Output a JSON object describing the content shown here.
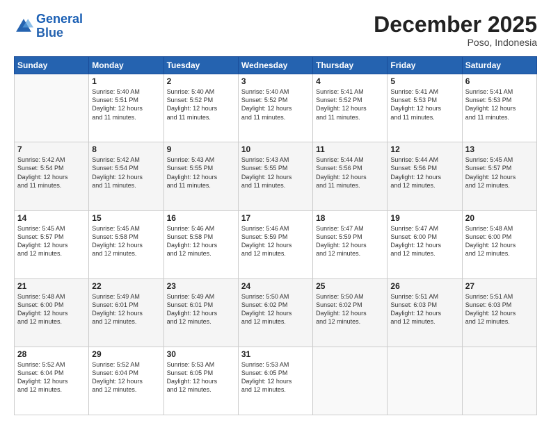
{
  "logo": {
    "line1": "General",
    "line2": "Blue"
  },
  "header": {
    "month": "December 2025",
    "location": "Poso, Indonesia"
  },
  "weekdays": [
    "Sunday",
    "Monday",
    "Tuesday",
    "Wednesday",
    "Thursday",
    "Friday",
    "Saturday"
  ],
  "weeks": [
    [
      {
        "day": "",
        "info": ""
      },
      {
        "day": "1",
        "info": "Sunrise: 5:40 AM\nSunset: 5:51 PM\nDaylight: 12 hours\nand 11 minutes."
      },
      {
        "day": "2",
        "info": "Sunrise: 5:40 AM\nSunset: 5:52 PM\nDaylight: 12 hours\nand 11 minutes."
      },
      {
        "day": "3",
        "info": "Sunrise: 5:40 AM\nSunset: 5:52 PM\nDaylight: 12 hours\nand 11 minutes."
      },
      {
        "day": "4",
        "info": "Sunrise: 5:41 AM\nSunset: 5:52 PM\nDaylight: 12 hours\nand 11 minutes."
      },
      {
        "day": "5",
        "info": "Sunrise: 5:41 AM\nSunset: 5:53 PM\nDaylight: 12 hours\nand 11 minutes."
      },
      {
        "day": "6",
        "info": "Sunrise: 5:41 AM\nSunset: 5:53 PM\nDaylight: 12 hours\nand 11 minutes."
      }
    ],
    [
      {
        "day": "7",
        "info": "Sunrise: 5:42 AM\nSunset: 5:54 PM\nDaylight: 12 hours\nand 11 minutes."
      },
      {
        "day": "8",
        "info": "Sunrise: 5:42 AM\nSunset: 5:54 PM\nDaylight: 12 hours\nand 11 minutes."
      },
      {
        "day": "9",
        "info": "Sunrise: 5:43 AM\nSunset: 5:55 PM\nDaylight: 12 hours\nand 11 minutes."
      },
      {
        "day": "10",
        "info": "Sunrise: 5:43 AM\nSunset: 5:55 PM\nDaylight: 12 hours\nand 11 minutes."
      },
      {
        "day": "11",
        "info": "Sunrise: 5:44 AM\nSunset: 5:56 PM\nDaylight: 12 hours\nand 11 minutes."
      },
      {
        "day": "12",
        "info": "Sunrise: 5:44 AM\nSunset: 5:56 PM\nDaylight: 12 hours\nand 12 minutes."
      },
      {
        "day": "13",
        "info": "Sunrise: 5:45 AM\nSunset: 5:57 PM\nDaylight: 12 hours\nand 12 minutes."
      }
    ],
    [
      {
        "day": "14",
        "info": "Sunrise: 5:45 AM\nSunset: 5:57 PM\nDaylight: 12 hours\nand 12 minutes."
      },
      {
        "day": "15",
        "info": "Sunrise: 5:45 AM\nSunset: 5:58 PM\nDaylight: 12 hours\nand 12 minutes."
      },
      {
        "day": "16",
        "info": "Sunrise: 5:46 AM\nSunset: 5:58 PM\nDaylight: 12 hours\nand 12 minutes."
      },
      {
        "day": "17",
        "info": "Sunrise: 5:46 AM\nSunset: 5:59 PM\nDaylight: 12 hours\nand 12 minutes."
      },
      {
        "day": "18",
        "info": "Sunrise: 5:47 AM\nSunset: 5:59 PM\nDaylight: 12 hours\nand 12 minutes."
      },
      {
        "day": "19",
        "info": "Sunrise: 5:47 AM\nSunset: 6:00 PM\nDaylight: 12 hours\nand 12 minutes."
      },
      {
        "day": "20",
        "info": "Sunrise: 5:48 AM\nSunset: 6:00 PM\nDaylight: 12 hours\nand 12 minutes."
      }
    ],
    [
      {
        "day": "21",
        "info": "Sunrise: 5:48 AM\nSunset: 6:00 PM\nDaylight: 12 hours\nand 12 minutes."
      },
      {
        "day": "22",
        "info": "Sunrise: 5:49 AM\nSunset: 6:01 PM\nDaylight: 12 hours\nand 12 minutes."
      },
      {
        "day": "23",
        "info": "Sunrise: 5:49 AM\nSunset: 6:01 PM\nDaylight: 12 hours\nand 12 minutes."
      },
      {
        "day": "24",
        "info": "Sunrise: 5:50 AM\nSunset: 6:02 PM\nDaylight: 12 hours\nand 12 minutes."
      },
      {
        "day": "25",
        "info": "Sunrise: 5:50 AM\nSunset: 6:02 PM\nDaylight: 12 hours\nand 12 minutes."
      },
      {
        "day": "26",
        "info": "Sunrise: 5:51 AM\nSunset: 6:03 PM\nDaylight: 12 hours\nand 12 minutes."
      },
      {
        "day": "27",
        "info": "Sunrise: 5:51 AM\nSunset: 6:03 PM\nDaylight: 12 hours\nand 12 minutes."
      }
    ],
    [
      {
        "day": "28",
        "info": "Sunrise: 5:52 AM\nSunset: 6:04 PM\nDaylight: 12 hours\nand 12 minutes."
      },
      {
        "day": "29",
        "info": "Sunrise: 5:52 AM\nSunset: 6:04 PM\nDaylight: 12 hours\nand 12 minutes."
      },
      {
        "day": "30",
        "info": "Sunrise: 5:53 AM\nSunset: 6:05 PM\nDaylight: 12 hours\nand 12 minutes."
      },
      {
        "day": "31",
        "info": "Sunrise: 5:53 AM\nSunset: 6:05 PM\nDaylight: 12 hours\nand 12 minutes."
      },
      {
        "day": "",
        "info": ""
      },
      {
        "day": "",
        "info": ""
      },
      {
        "day": "",
        "info": ""
      }
    ]
  ]
}
